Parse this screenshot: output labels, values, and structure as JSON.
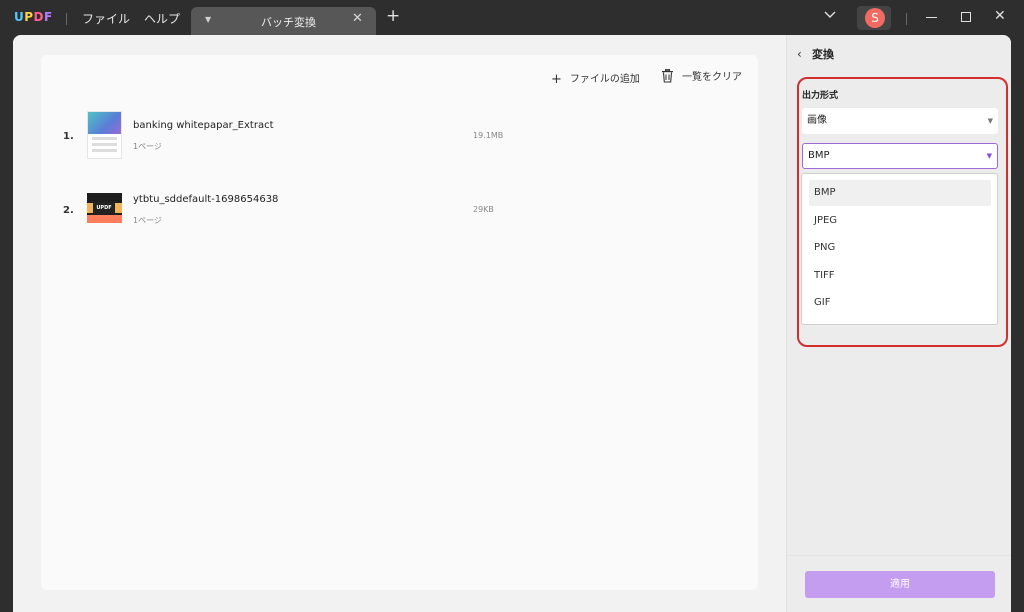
{
  "app": {
    "logo_text": [
      "U",
      "P",
      "D",
      "F"
    ],
    "menu": {
      "file": "ファイル",
      "help": "ヘルプ"
    },
    "tab": {
      "title": "バッチ変換",
      "close": "✕"
    },
    "add_tab": "+",
    "user_initial": "S",
    "window_close": "✕"
  },
  "toolbar": {
    "add_files": "ファイルの追加",
    "clear_list": "一覧をクリア"
  },
  "files": [
    {
      "index": "1.",
      "name": "banking whitepapar_Extract",
      "pages": "1ページ",
      "size": "19.1MB"
    },
    {
      "index": "2.",
      "name": "ytbtu_sddefault-1698654638",
      "pages": "1ページ",
      "size": "29KB"
    }
  ],
  "panel": {
    "title": "変換",
    "output_format_label": "出力形式",
    "type_value": "画像",
    "format_value": "BMP",
    "format_options": [
      "BMP",
      "JPEG",
      "PNG",
      "TIFF",
      "GIF"
    ],
    "apply_label": "適用"
  },
  "colors": {
    "accent": "#9b6ad6",
    "apply_button": "#c49cf0",
    "highlight": "#d32f2f",
    "avatar": "#f26b62"
  }
}
